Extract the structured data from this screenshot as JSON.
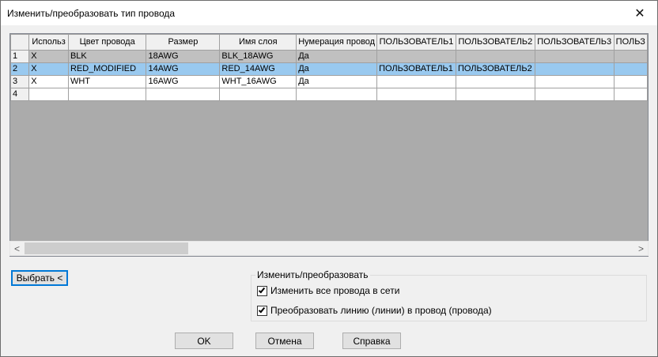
{
  "window": {
    "title": "Изменить/преобразовать тип провода",
    "close_glyph": "✕"
  },
  "grid": {
    "columns": [
      {
        "label": "Использ"
      },
      {
        "label": "Цвет провода"
      },
      {
        "label": "Размер"
      },
      {
        "label": "Имя слоя"
      },
      {
        "label": "Нумерация провод"
      },
      {
        "label": "ПОЛЬЗОВАТЕЛЬ1"
      },
      {
        "label": "ПОЛЬЗОВАТЕЛЬ2"
      },
      {
        "label": "ПОЛЬЗОВАТЕЛЬ3"
      },
      {
        "label": "ПОЛЬЗ"
      }
    ],
    "rows": [
      {
        "num": "1",
        "cells": [
          "X",
          "BLK",
          "18AWG",
          "BLK_18AWG",
          "Да",
          "",
          "",
          "",
          ""
        ],
        "state": "gray"
      },
      {
        "num": "2",
        "cells": [
          "X",
          "RED_MODIFIED",
          "14AWG",
          "RED_14AWG",
          "Да",
          "ПОЛЬЗОВАТЕЛЬ1",
          "ПОЛЬЗОВАТЕЛЬ2",
          "",
          ""
        ],
        "state": "selected"
      },
      {
        "num": "3",
        "cells": [
          "X",
          "WHT",
          "16AWG",
          "WHT_16AWG",
          "Да",
          "",
          "",
          "",
          ""
        ],
        "state": "normal"
      },
      {
        "num": "4",
        "cells": [
          "",
          "",
          "",
          "",
          "",
          "",
          "",
          "",
          ""
        ],
        "state": "normal"
      }
    ]
  },
  "scrollbar": {
    "left_arrow": "<",
    "right_arrow": ">"
  },
  "select_button": {
    "label": "Выбрать <"
  },
  "group": {
    "legend": "Изменить/преобразовать",
    "check1": {
      "label": "Изменить все провода в сети",
      "checked": true
    },
    "check2": {
      "label": "Преобразовать линию (линии) в провод (провода)",
      "checked": true
    }
  },
  "buttons": {
    "ok": "OK",
    "cancel": "Отмена",
    "help": "Справка"
  }
}
